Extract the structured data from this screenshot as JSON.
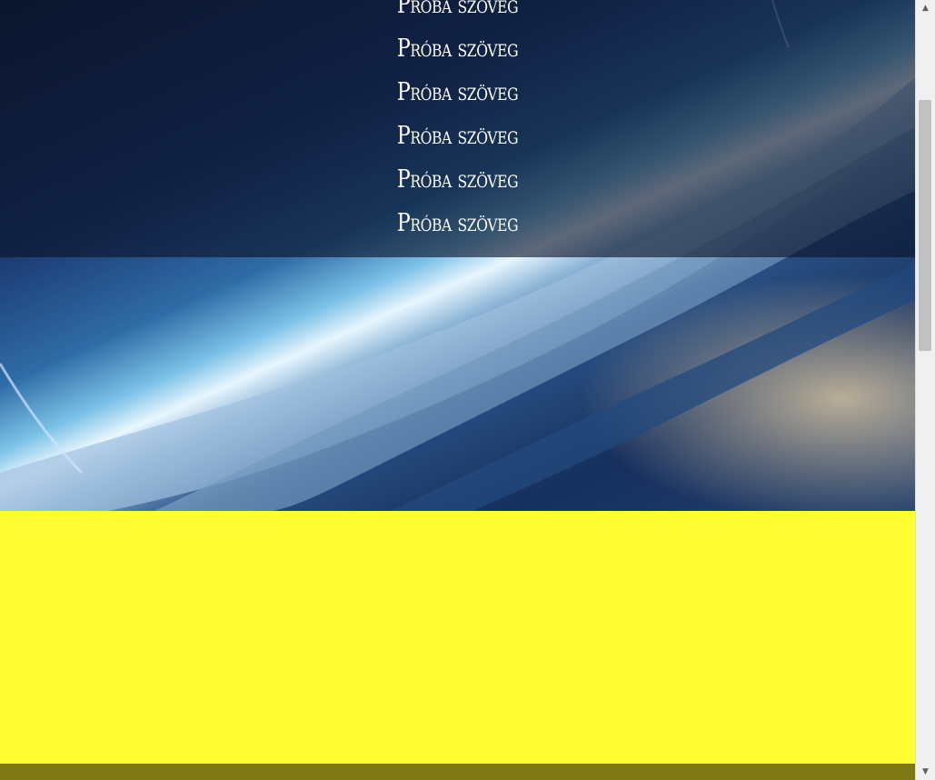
{
  "hero": {
    "lines": [
      "Próba szöveg",
      "Próba szöveg",
      "Próba szöveg",
      "Próba szöveg",
      "Próba szöveg",
      "Próba szöveg"
    ]
  },
  "colors": {
    "yellow_section": "#ffff33",
    "footer_bar": "#7e7914",
    "text": "#ffffff"
  },
  "scrollbar": {
    "up_icon": "arrow-up-icon",
    "down_icon": "arrow-down-icon",
    "position_fraction": 0.13
  }
}
